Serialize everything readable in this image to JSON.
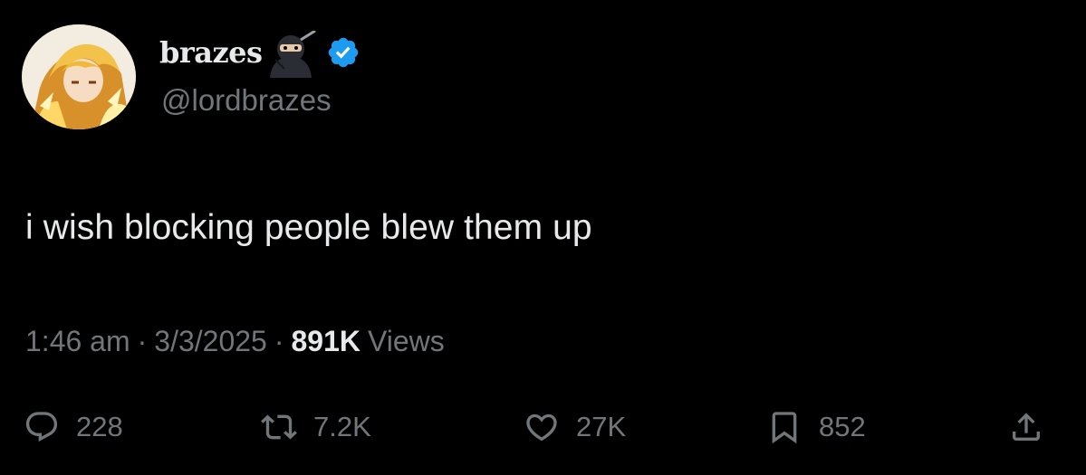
{
  "author": {
    "display_name": "brazes",
    "handle": "@lordbrazes",
    "avatar_icon": "anime-avatar",
    "name_emoji": "ninja-icon",
    "verified_icon": "verified-badge-icon",
    "verified_color": "#1d9bf0"
  },
  "tweet": {
    "text": "i wish blocking people blew them up"
  },
  "meta": {
    "time": "1:46 am",
    "separator": "·",
    "date": "3/3/2025",
    "views_count": "891K",
    "views_label": "Views"
  },
  "actions": {
    "reply": {
      "icon": "reply-icon",
      "count": "228"
    },
    "retweet": {
      "icon": "retweet-icon",
      "count": "7.2K"
    },
    "like": {
      "icon": "heart-icon",
      "count": "27K"
    },
    "bookmark": {
      "icon": "bookmark-icon",
      "count": "852"
    },
    "share": {
      "icon": "share-icon"
    }
  },
  "colors": {
    "background": "#000000",
    "primary_text": "#e7e9ea",
    "secondary_text": "#71767b"
  }
}
